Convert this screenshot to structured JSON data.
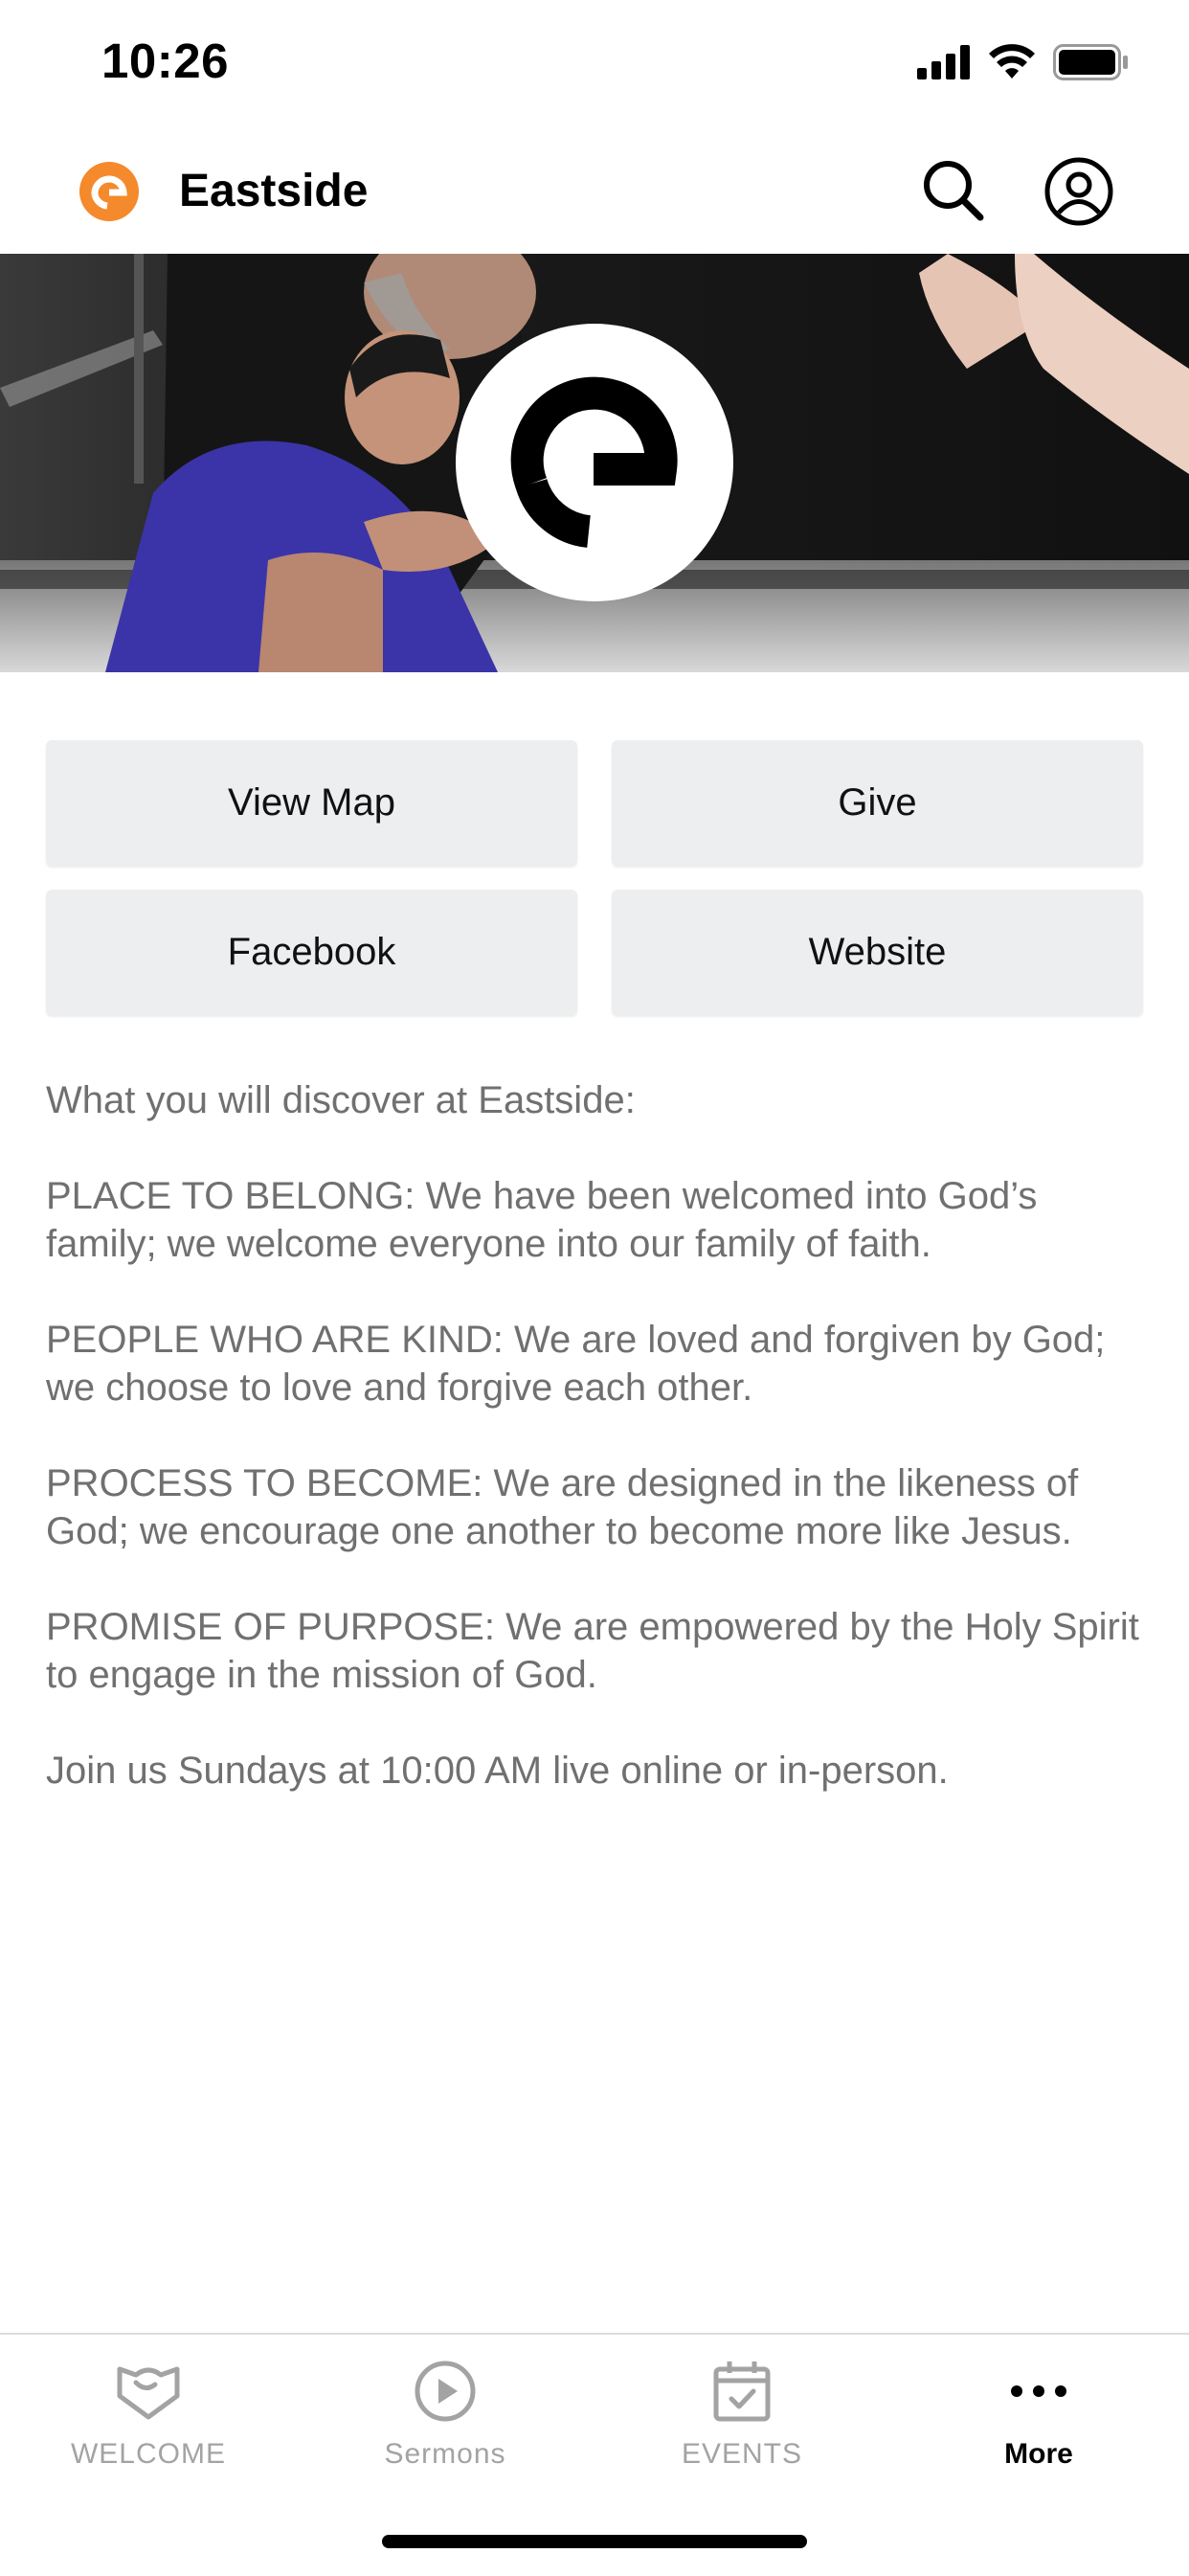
{
  "status_bar": {
    "time": "10:26"
  },
  "app_bar": {
    "title": "Eastside"
  },
  "colors": {
    "brand_orange": "#f48a2c",
    "tile_bg": "#edeef0",
    "body_text": "#707070",
    "tab_inactive": "#a3a3a3"
  },
  "hero": {
    "icon": "eastside-logo-icon"
  },
  "buttons": {
    "view_map": "View Map",
    "give": "Give",
    "facebook": "Facebook",
    "website": "Website"
  },
  "description": {
    "intro": "What you will discover at Eastside:",
    "p1": "PLACE TO BELONG: We have been welcomed into God’s family; we welcome everyone into our family of faith.",
    "p2": "PEOPLE WHO ARE KIND: We are loved and forgiven by God; we choose to love and forgive each other.",
    "p3": "PROCESS TO BECOME: We are designed in the likeness of God; we encourage one another to become more like Jesus.",
    "p4": "PROMISE OF PURPOSE: We are empowered by the Holy Spirit to engage in the mission of God.",
    "p5": "Join us Sundays at 10:00 AM live online or in-person."
  },
  "tabs": [
    {
      "label": "WELCOME",
      "icon": "handshake-shield-icon",
      "active": false
    },
    {
      "label": "Sermons",
      "icon": "play-circle-icon",
      "active": false
    },
    {
      "label": "EVENTS",
      "icon": "calendar-check-icon",
      "active": false
    },
    {
      "label": "More",
      "icon": "more-dots-icon",
      "active": true
    }
  ]
}
